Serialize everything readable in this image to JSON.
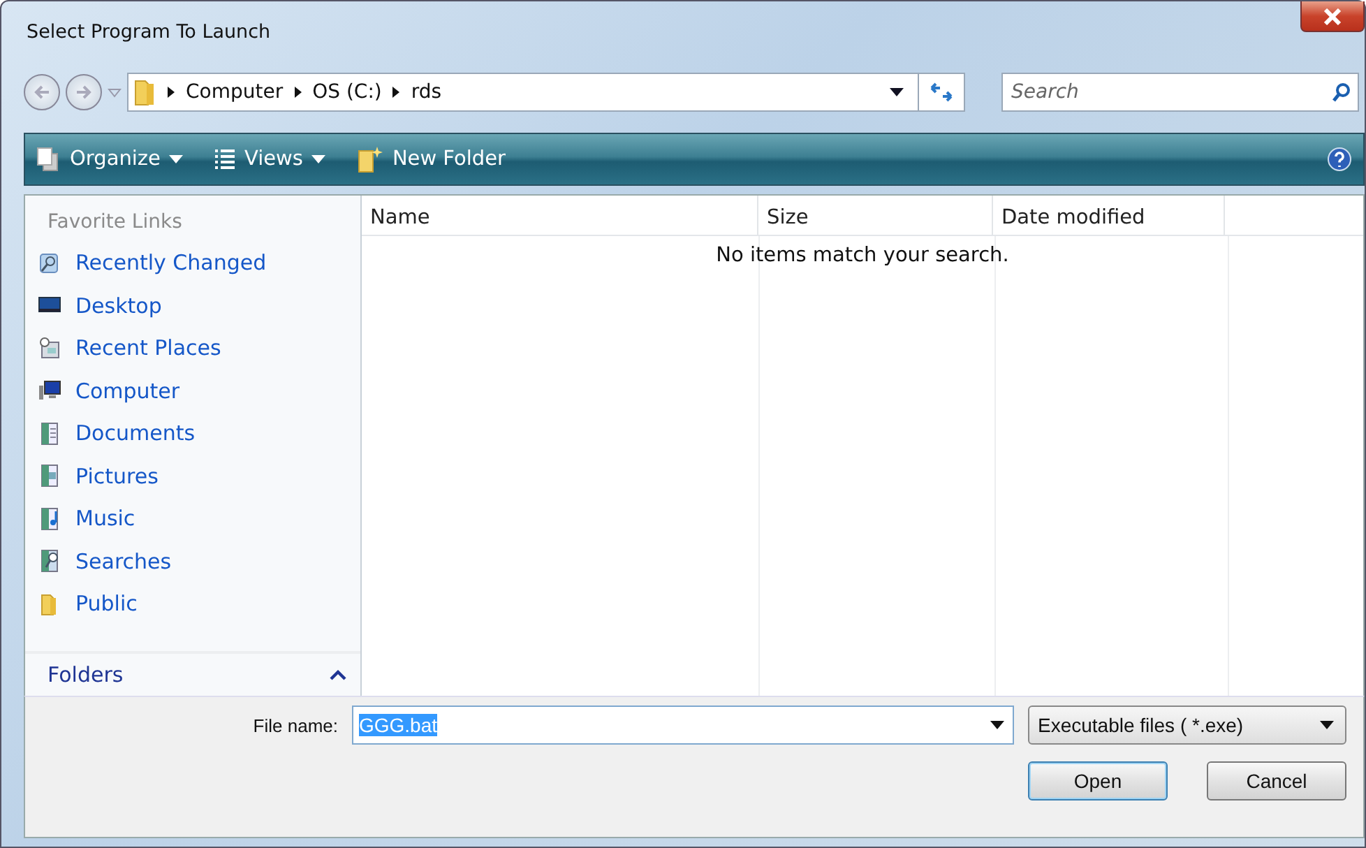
{
  "window": {
    "title": "Select Program To Launch"
  },
  "address": {
    "path": [
      "Computer",
      "OS (C:)",
      "rds"
    ]
  },
  "search": {
    "placeholder": "Search"
  },
  "toolbar": [
    {
      "label": "Organize",
      "kind": "organize",
      "dropdown": true
    },
    {
      "label": "Views",
      "kind": "views",
      "dropdown": true
    },
    {
      "label": "New Folder",
      "kind": "new-folder",
      "dropdown": false
    }
  ],
  "sidebar": {
    "heading": "Favorite Links",
    "items": [
      {
        "label": "Recently Changed",
        "kind": "search-folder"
      },
      {
        "label": "Desktop",
        "kind": "desktop"
      },
      {
        "label": "Recent Places",
        "kind": "recent"
      },
      {
        "label": "Computer",
        "kind": "computer"
      },
      {
        "label": "Documents",
        "kind": "documents"
      },
      {
        "label": "Pictures",
        "kind": "pictures"
      },
      {
        "label": "Music",
        "kind": "music"
      },
      {
        "label": "Searches",
        "kind": "searches"
      },
      {
        "label": "Public",
        "kind": "folder"
      }
    ],
    "folders": {
      "label": "Folders",
      "expanded": false
    }
  },
  "table": {
    "columns": [
      "Name",
      "Size",
      "Date modified"
    ],
    "empty_message": "No items match your search."
  },
  "file_name": {
    "label": "File name:",
    "value": "GGG.bat",
    "text_selected": true
  },
  "file_type": {
    "value": "Executable files  ( *.exe)"
  },
  "buttons": [
    {
      "label": "Open",
      "default": true
    },
    {
      "label": "Cancel",
      "default": false
    }
  ]
}
